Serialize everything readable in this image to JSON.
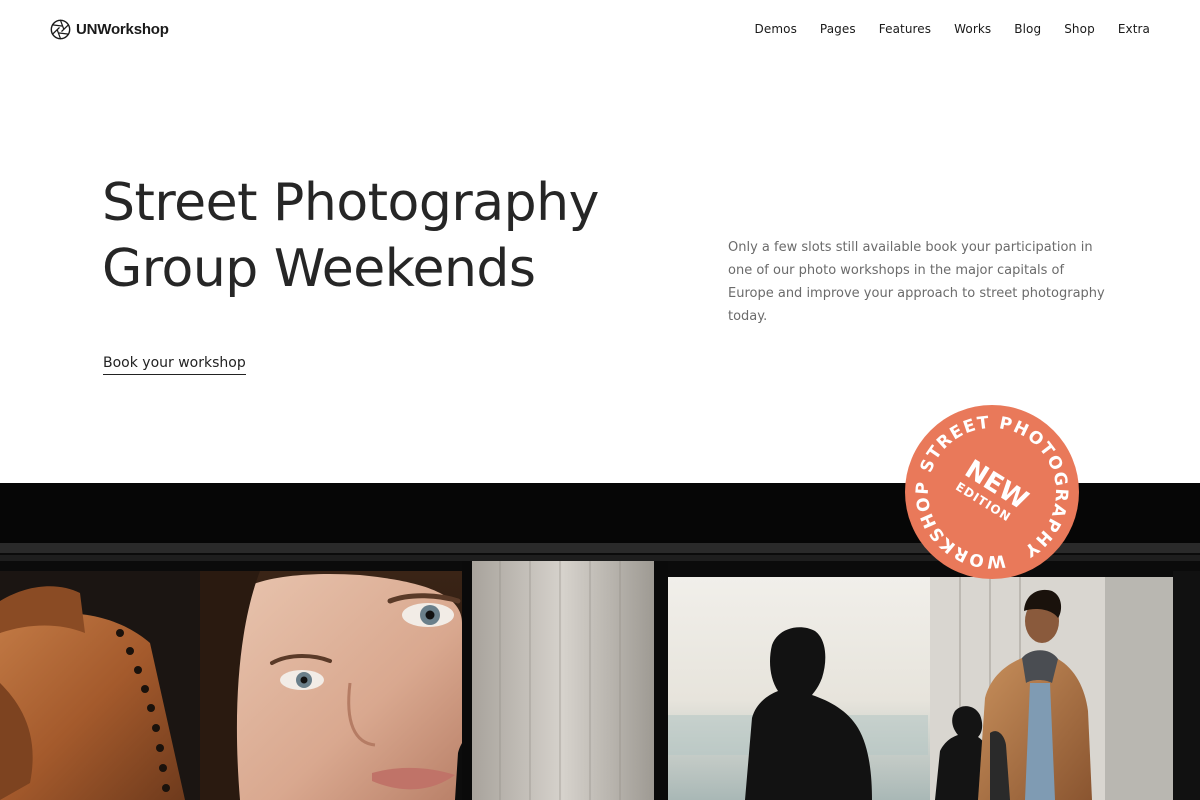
{
  "header": {
    "brand": "UNWorkshop",
    "logo_icon": "camera-aperture-icon",
    "nav": [
      {
        "label": "Demos"
      },
      {
        "label": "Pages"
      },
      {
        "label": "Features"
      },
      {
        "label": "Works"
      },
      {
        "label": "Blog"
      },
      {
        "label": "Shop"
      },
      {
        "label": "Extra"
      }
    ]
  },
  "hero": {
    "title_line1": "Street Photography",
    "title_line2": "Group Weekends",
    "description": "Only a few slots still available book your participation in one of our photo workshops in the major capitals of Europe and improve your approach to street photography today.",
    "cta_label": "Book your workshop"
  },
  "badge": {
    "ring_text": "WORKSHOP STREET PHOTOGRAPHY",
    "main": "NEW",
    "sub": "EDITION",
    "color": "#e9795a"
  },
  "colors": {
    "text": "#262626",
    "muted": "#6b6b6b",
    "accent": "#e9795a"
  }
}
